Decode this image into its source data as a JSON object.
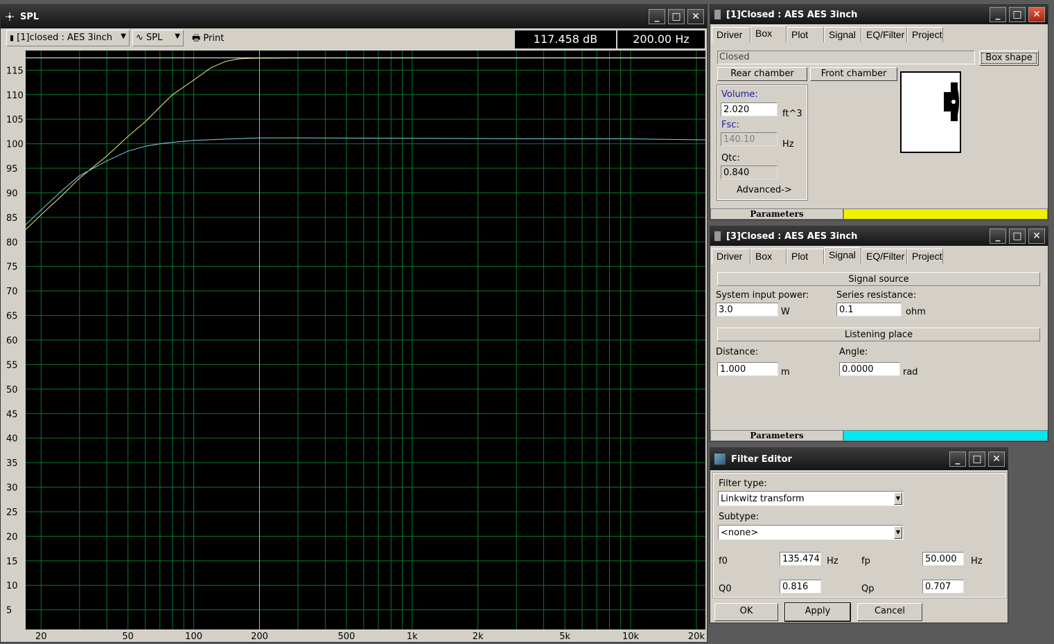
{
  "spl_window": {
    "title": "SPL",
    "toolbar": {
      "curve_select": "[1]closed : AES 3inch",
      "plot_type": "SPL",
      "print_label": "Print",
      "readout_db": "117.458 dB",
      "readout_hz": "200.00 Hz"
    }
  },
  "chart_data": {
    "type": "line",
    "x_scale": "log",
    "xlim": [
      17,
      22000
    ],
    "ylim": [
      1,
      119
    ],
    "x_ticks": [
      20,
      50,
      100,
      200,
      500,
      1000,
      2000,
      5000,
      10000,
      20000
    ],
    "x_tick_labels": [
      "20",
      "50",
      "100",
      "200",
      "500",
      "1k",
      "2k",
      "5k",
      "10k",
      "20k"
    ],
    "y_ticks": [
      5,
      10,
      15,
      20,
      25,
      30,
      35,
      40,
      45,
      50,
      55,
      60,
      65,
      70,
      75,
      80,
      85,
      90,
      95,
      100,
      105,
      110,
      115
    ],
    "y_tick_labels": [
      "5",
      "10",
      "15",
      "20",
      "25",
      "30",
      "35",
      "40",
      "45",
      "50",
      "55",
      "60",
      "65",
      "70",
      "75",
      "80",
      "85",
      "90",
      "95",
      "100",
      "105",
      "110",
      "115"
    ],
    "grid": true,
    "cursor_x": 200,
    "series": [
      {
        "color": "#f0f080",
        "x": [
          17,
          20,
          25,
          30,
          40,
          50,
          60,
          70,
          80,
          100,
          120,
          140,
          160,
          180,
          200,
          300,
          500,
          1000,
          2000,
          5000,
          10000,
          20000,
          22000
        ],
        "y": [
          82.5,
          85.5,
          89.5,
          93,
          97.5,
          101.5,
          104.5,
          107.5,
          110,
          113,
          115.5,
          116.8,
          117.3,
          117.4,
          117.45,
          117.5,
          117.5,
          117.5,
          117.5,
          117.5,
          117.5,
          117.5,
          117.5
        ]
      },
      {
        "color": "#ffffff",
        "x": [
          17,
          22000
        ],
        "y": [
          117.5,
          117.5
        ]
      },
      {
        "color": "#7fd8e8",
        "x": [
          17,
          20,
          25,
          30,
          40,
          50,
          60,
          70,
          80,
          100,
          150,
          200,
          300,
          1000,
          5000,
          10000,
          20000,
          22000
        ],
        "y": [
          83.5,
          86.5,
          90.5,
          93.5,
          96.5,
          98.5,
          99.5,
          100,
          100.3,
          100.7,
          101,
          101.2,
          101.2,
          101.1,
          101,
          101,
          100.8,
          100.8
        ]
      }
    ]
  },
  "box_window": {
    "title": "[1]Closed : AES AES 3inch",
    "tabs": [
      "Driver",
      "Box",
      "Plot",
      "Signal",
      "EQ/Filter",
      "Project"
    ],
    "active_tab": "Box",
    "box_type": "Closed",
    "box_shape_button": "Box shape",
    "rear_chamber": "Rear chamber",
    "front_chamber": "Front chamber",
    "volume_label": "Volume:",
    "volume_value": "2.020",
    "volume_unit": "ft^3",
    "fsc_label": "Fsc:",
    "fsc_value": "140.10",
    "fsc_unit": "Hz",
    "qtc_label": "Qtc:",
    "qtc_value": "0.840",
    "advanced": "Advanced->",
    "parameters": "Parameters",
    "param_color": "#f0f000"
  },
  "signal_window": {
    "title": "[3]Closed : AES AES 3inch",
    "tabs": [
      "Driver",
      "Box",
      "Plot",
      "Signal",
      "EQ/Filter",
      "Project"
    ],
    "active_tab": "Signal",
    "signal_source": "Signal source",
    "input_power_label": "System input power:",
    "input_power_value": "3.0",
    "input_power_unit": "W",
    "series_res_label": "Series resistance:",
    "series_res_value": "0.1",
    "series_res_unit": "ohm",
    "listening_place": "Listening place",
    "distance_label": "Distance:",
    "distance_value": "1.000",
    "distance_unit": "m",
    "angle_label": "Angle:",
    "angle_value": "0.0000",
    "angle_unit": "rad",
    "parameters": "Parameters",
    "param_color": "#00e8f0"
  },
  "filter_window": {
    "title": "Filter Editor",
    "filter_type_label": "Filter type:",
    "filter_type_value": "Linkwitz transform",
    "subtype_label": "Subtype:",
    "subtype_value": "<none>",
    "f0_label": "f0",
    "f0_value": "135.474",
    "f0_unit": "Hz",
    "fp_label": "fp",
    "fp_value": "50.000",
    "fp_unit": "Hz",
    "q0_label": "Q0",
    "q0_value": "0.816",
    "qp_label": "Qp",
    "qp_value": "0.707",
    "ok": "OK",
    "apply": "Apply",
    "cancel": "Cancel"
  }
}
